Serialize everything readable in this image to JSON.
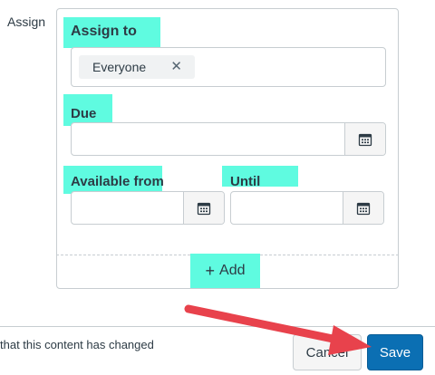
{
  "side_label": "Assign",
  "assign_to": {
    "label": "Assign to",
    "tag": "Everyone",
    "remove_icon": "close-icon"
  },
  "due": {
    "label": "Due",
    "value": "",
    "calendar_icon": "calendar-icon"
  },
  "available_from": {
    "label": "Available from",
    "value": "",
    "calendar_icon": "calendar-icon"
  },
  "until": {
    "label": "Until",
    "value": "",
    "calendar_icon": "calendar-icon"
  },
  "add": {
    "icon": "plus-icon",
    "label": "Add"
  },
  "footer": {
    "notify_text": "that this content has changed",
    "cancel_label": "Cancel",
    "save_label": "Save"
  },
  "colors": {
    "highlight": "#5ffbe0",
    "save_button": "#0b6fb3",
    "annotation_arrow": "#e8424c"
  }
}
